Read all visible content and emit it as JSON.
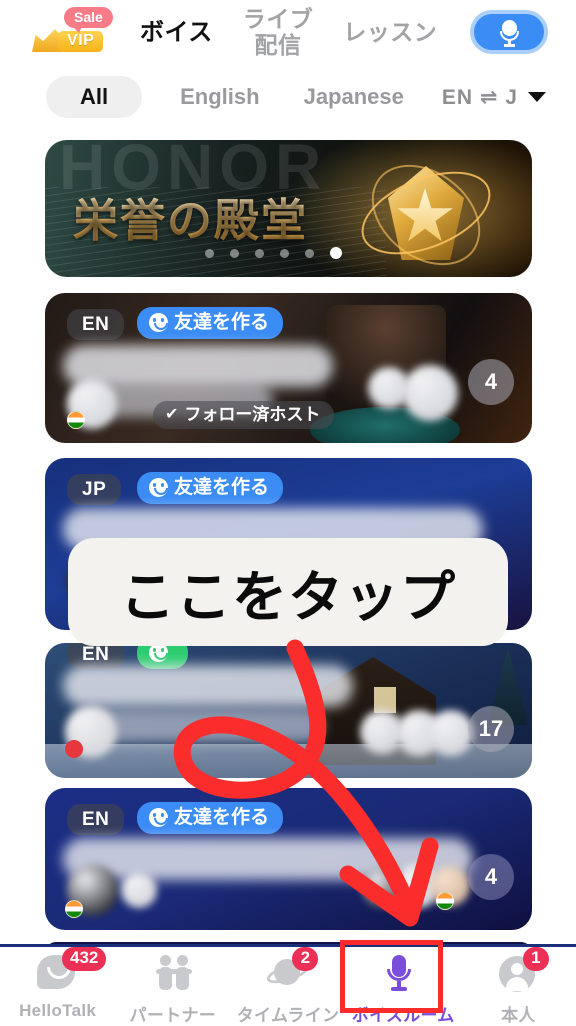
{
  "header": {
    "vip": {
      "sale_label": "Sale",
      "vip_label": "VIP",
      "icon": "crown-icon"
    },
    "tabs": [
      {
        "label": "ボイス",
        "active": true
      },
      {
        "label": "ライブ\n配信",
        "active": false
      },
      {
        "label": "レッスン",
        "active": false
      }
    ],
    "mic_button": {
      "icon": "microphone-icon",
      "color": "#3b8cf5"
    }
  },
  "filters": {
    "chips": [
      {
        "label": "All",
        "active": true
      },
      {
        "label": "English",
        "active": false
      },
      {
        "label": "Japanese",
        "active": false
      }
    ],
    "lang_swap": {
      "label": "EN ⇌ J",
      "chevron": "chevron-down-icon"
    }
  },
  "banner": {
    "title": "栄誉の殿堂",
    "watermark": "HONOR",
    "dots_total": 6,
    "dots_active_index": 5
  },
  "rooms": [
    {
      "lang": "EN",
      "tag": "友達を作る",
      "tag_color": "#3b8cf5",
      "follow_badge": "フォロー済ホスト",
      "count": "4",
      "theme": "cafe"
    },
    {
      "lang": "JP",
      "tag": "友達を作る",
      "tag_color": "#3b8cf5",
      "count": "",
      "theme": "blue"
    },
    {
      "lang": "EN",
      "tag": "",
      "tag_color": "#2ecc71",
      "count": "17",
      "theme": "winter"
    },
    {
      "lang": "EN",
      "tag": "友達を作る",
      "tag_color": "#3b8cf5",
      "count": "4",
      "theme": "navy"
    }
  ],
  "overlay": {
    "tooltip_text": "ここをタップ",
    "arrow_color": "#fb2c2c",
    "highlight_color": "#fb2c2c"
  },
  "bottom_nav": [
    {
      "label": "HelloTalk",
      "badge": "432",
      "icon": "chat-icon",
      "active": false
    },
    {
      "label": "パートナー",
      "badge": "",
      "icon": "partners-icon",
      "active": false
    },
    {
      "label": "タイムライン",
      "badge": "2",
      "icon": "planet-icon",
      "active": false
    },
    {
      "label": "ボイスルーム",
      "badge": "",
      "icon": "microphone-icon",
      "active": true
    },
    {
      "label": "本人",
      "badge": "1",
      "icon": "person-icon",
      "active": false
    }
  ]
}
